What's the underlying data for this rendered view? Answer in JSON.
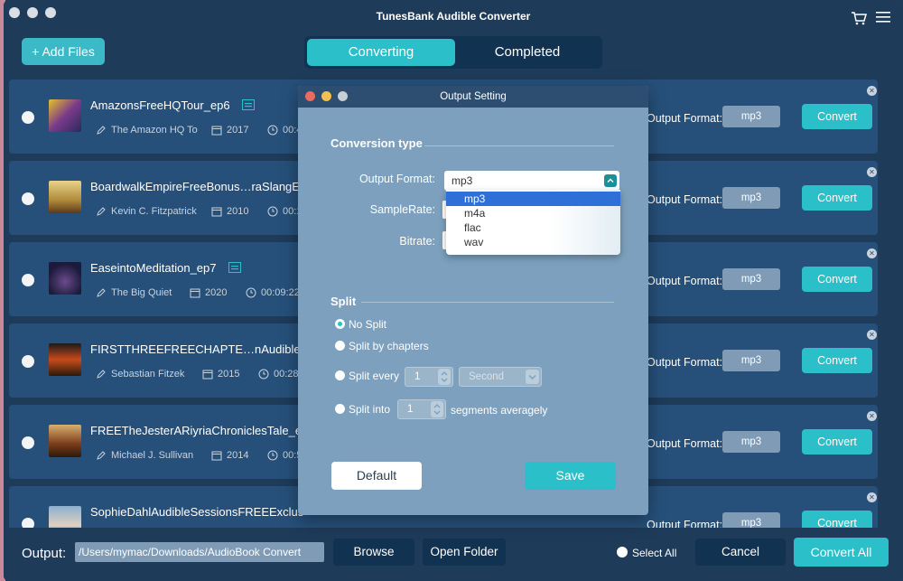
{
  "window": {
    "title": "TunesBank Audible Converter"
  },
  "header": {
    "add_files": "+ Add Files",
    "tabs": [
      {
        "label": "Converting"
      },
      {
        "label": "Completed"
      }
    ]
  },
  "rows": [
    {
      "title": "AmazonsFreeHQTour_ep6",
      "author": "The Amazon HQ To",
      "year": "2017",
      "duration": "00:4",
      "output_format_label": "Output Format:",
      "format": "mp3",
      "convert": "Convert"
    },
    {
      "title": "BoardwalkEmpireFreeBonus…raSlangE",
      "author": "Kevin C. Fitzpatrick",
      "year": "2010",
      "duration": "00:1",
      "output_format_label": "Output Format:",
      "format": "mp3",
      "convert": "Convert"
    },
    {
      "title": "EaseintoMeditation_ep7",
      "author": "The Big Quiet",
      "year": "2020",
      "duration": "00:09:22",
      "output_format_label": "Output Format:",
      "format": "mp3",
      "convert": "Convert"
    },
    {
      "title": "FIRSTTHREEFREECHAPTE…nAudible",
      "author": "Sebastian Fitzek",
      "year": "2015",
      "duration": "00:28",
      "output_format_label": "Output Format:",
      "format": "mp3",
      "convert": "Convert"
    },
    {
      "title": "FREETheJesterARiyriaChroniclesTale_e",
      "author": "Michael J. Sullivan",
      "year": "2014",
      "duration": "00:5",
      "output_format_label": "Output Format:",
      "format": "mp3",
      "convert": "Convert"
    },
    {
      "title": "SophieDahlAudibleSessionsFREEExclus",
      "author": "",
      "year": "",
      "duration": "",
      "output_format_label": "Output Format:",
      "format": "mp3",
      "convert": "Convert"
    }
  ],
  "footer": {
    "output_label": "Output:",
    "output_path": "/Users/mymac/Downloads/AudioBook Convert",
    "browse": "Browse",
    "open_folder": "Open Folder",
    "select_all": "Select All",
    "cancel": "Cancel",
    "convert_all": "Convert All"
  },
  "dialog": {
    "title": "Output Setting",
    "conversion_type": "Conversion type",
    "output_format_label": "Output Format:",
    "output_format_value": "mp3",
    "format_options": [
      "mp3",
      "m4a",
      "flac",
      "wav"
    ],
    "sample_rate_label": "SampleRate:",
    "bitrate_label": "Bitrate:",
    "split_title": "Split",
    "no_split": "No Split",
    "split_by_chapters": "Split by chapters",
    "split_every": "Split every",
    "split_every_value": "1",
    "split_unit": "Second",
    "split_into": "Split into",
    "split_into_value": "1",
    "segments_averagely": "segments averagely",
    "default": "Default",
    "save": "Save"
  },
  "colors": {
    "accent": "#2bbfc9",
    "background": "#1e3b5a",
    "row": "#26507a",
    "dialog": "#7ca0bd"
  }
}
